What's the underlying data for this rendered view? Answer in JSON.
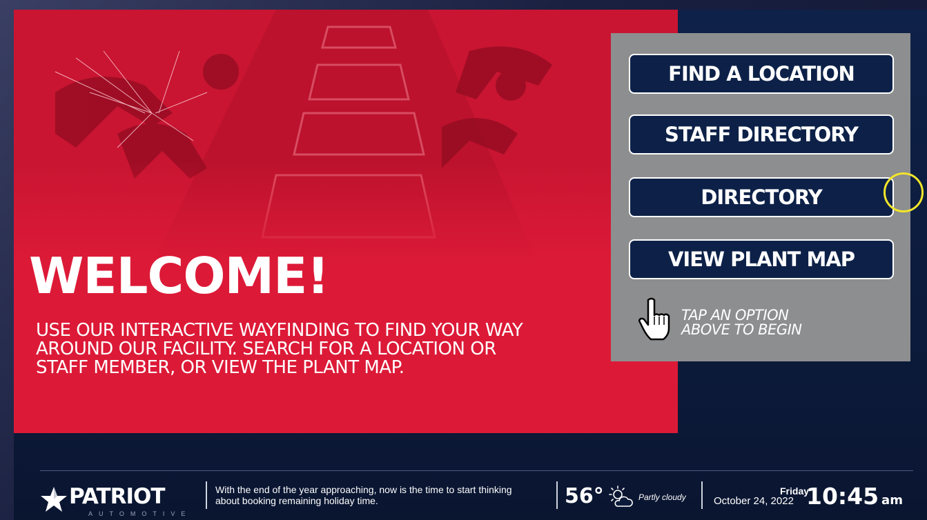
{
  "hero": {
    "title": "WELCOME!",
    "description": "USE OUR INTERACTIVE WAYFINDING TO FIND YOUR WAY AROUND OUR FACILITY. SEARCH FOR A LOCATION OR STAFF MEMBER, OR VIEW THE PLANT MAP."
  },
  "menu": {
    "buttons": [
      "FIND A LOCATION",
      "STAFF DIRECTORY",
      "DIRECTORY",
      "VIEW PLANT MAP"
    ],
    "hint": "TAP AN OPTION ABOVE TO BEGIN"
  },
  "footer": {
    "brand": "PATRIOT",
    "brand_sub": "AUTOMOTIVE",
    "message": "With the end of the year approaching, now is the time to start thinking about booking remaining holiday time.",
    "temperature": "56°",
    "weather_icon": "partly-cloudy-icon",
    "condition": "Partly cloudy",
    "weekday": "Friday",
    "date": "October 24, 2022",
    "time": "10:45",
    "ampm": "am"
  },
  "colors": {
    "hero_red": "#dc1a37",
    "navy": "#0d2148",
    "panel_gray": "#8d8e8f",
    "highlight": "#f3e62a"
  }
}
